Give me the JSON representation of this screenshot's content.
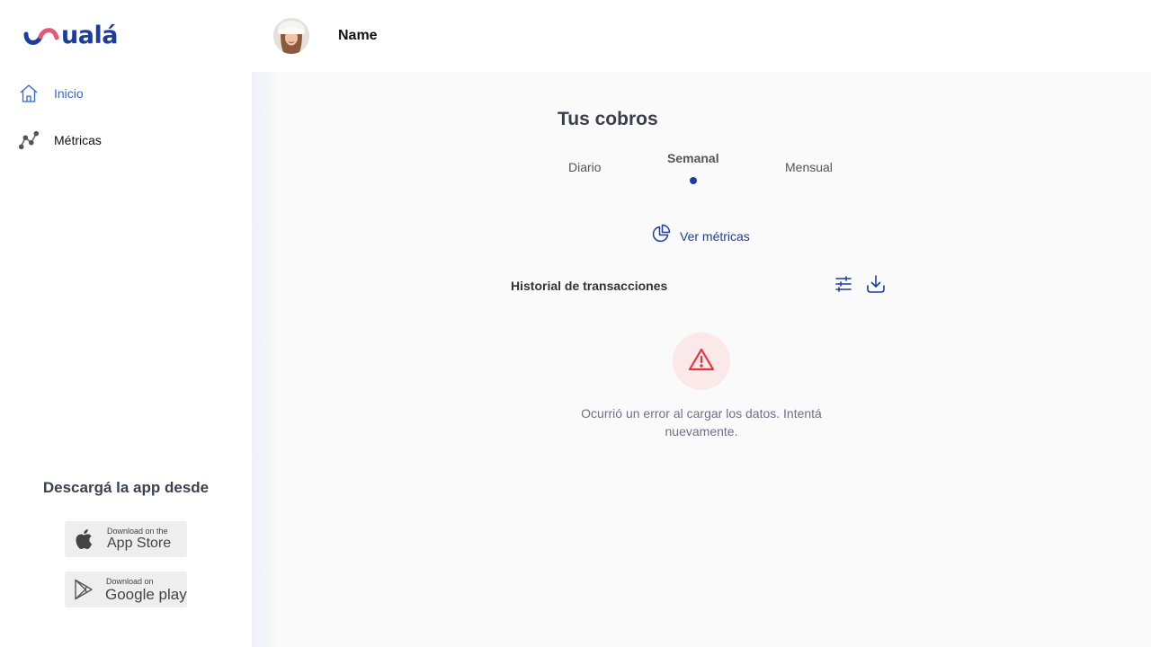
{
  "brand": {
    "name": "ualá",
    "accent": "#1d3d9e",
    "logo_pink": "#e8577a"
  },
  "sidebar": {
    "items": [
      {
        "label": "Inicio",
        "icon": "home-icon",
        "active": true
      },
      {
        "label": "Métricas",
        "icon": "metrics-icon",
        "active": false
      }
    ],
    "download_title": "Descargá la app desde",
    "stores": [
      {
        "small": "Download on the",
        "big": "App Store",
        "icon": "apple-icon"
      },
      {
        "small": "Download on",
        "big": "Google play",
        "icon": "google-play-icon"
      }
    ]
  },
  "header": {
    "user_name": "Name"
  },
  "main": {
    "title": "Tus cobros",
    "tabs": [
      {
        "label": "Diario",
        "selected": false
      },
      {
        "label": "Semanal",
        "selected": true
      },
      {
        "label": "Mensual",
        "selected": false
      }
    ],
    "metrics_link": "Ver métricas",
    "history_title": "Historial de transacciones",
    "error_message": "Ocurrió un error al cargar los datos. Intentá nuevamente.",
    "error_color": "#e8343e"
  }
}
